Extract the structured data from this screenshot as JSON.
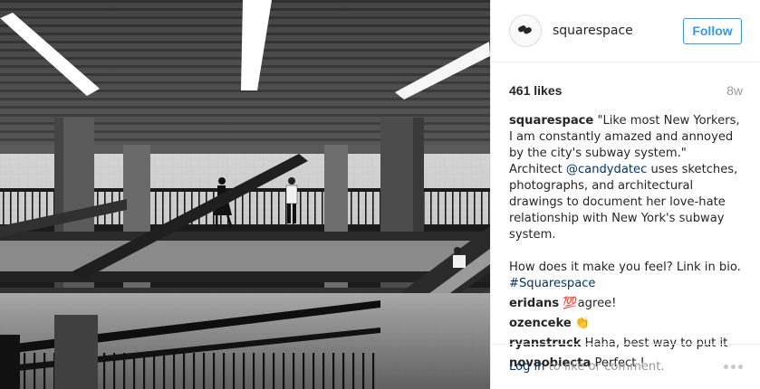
{
  "post": {
    "username": "squarespace",
    "follow_label": "Follow",
    "likes": "461 likes",
    "age": "8w",
    "caption": {
      "username": "squarespace",
      "text_before_mention": " \"Like most New Yorkers, I am constantly amazed and annoyed by the city's subway system.\" Architect ",
      "mention": "@candydatec",
      "text_after_mention": " uses sketches, photographs, and architectural drawings to document her love-hate relationship with New York's subway system.",
      "line2": "How does it make you feel? Link in bio.",
      "hashtag": "#Squarespace"
    },
    "comments": [
      {
        "username": "eridans",
        "emoji": "💯",
        "text": "agree!"
      },
      {
        "username": "ozenceke",
        "emoji": "👏",
        "text": ""
      },
      {
        "username": "ryanstruck",
        "emoji": "",
        "text": "Haha, best way to put it"
      },
      {
        "username": "novaobiecta",
        "emoji": "",
        "text": "Perfect !"
      }
    ],
    "footer": {
      "login_label": "Log in",
      "footer_text": " to like or comment."
    }
  },
  "icons": {
    "avatar": "squarespace-logo-icon",
    "more": "more-options-icon"
  },
  "colors": {
    "accent": "#3897f0",
    "link": "#003569",
    "muted": "#999999"
  }
}
